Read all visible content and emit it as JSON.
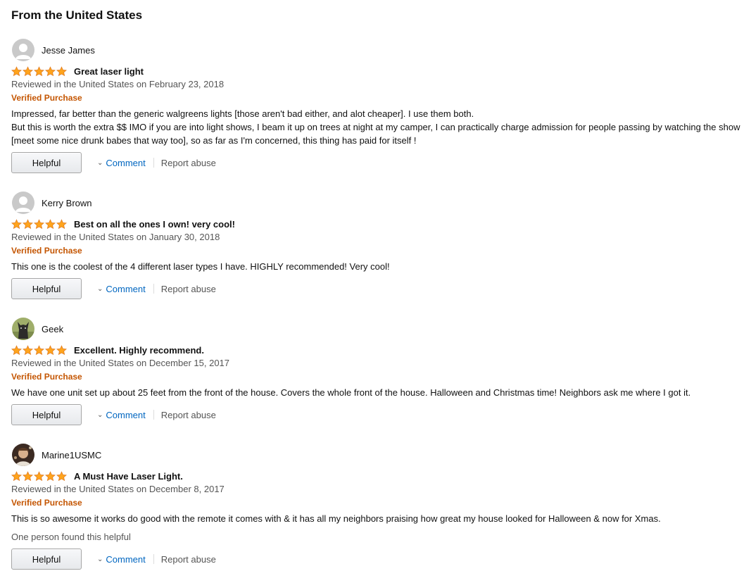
{
  "section_title": "From the United States",
  "colors": {
    "star": "#ffa41c",
    "verified": "#c45500",
    "link": "#0066c0"
  },
  "labels": {
    "helpful": "Helpful",
    "comment": "Comment",
    "report": "Report abuse"
  },
  "reviews": [
    {
      "name": "Jesse James",
      "avatar": "default-avatar-icon",
      "rating": 5,
      "title": "Great laser light",
      "date": "Reviewed in the United States on February 23, 2018",
      "verified": "Verified Purchase",
      "body": [
        "Impressed, far better than the generic walgreens lights [those aren't bad either, and alot cheaper]. I use them both.",
        "But this is worth the extra $$ IMO if you are into light shows, I beam it up on trees at night at my camper, I can practically charge admission for people passing by watching the show [meet some nice drunk babes that way too], so as far as I'm concerned, this thing has paid for itself !"
      ],
      "helpful_count": ""
    },
    {
      "name": "Kerry Brown",
      "avatar": "default-avatar-icon",
      "rating": 5,
      "title": "Best on all the ones I own! very cool!",
      "date": "Reviewed in the United States on January 30, 2018",
      "verified": "Verified Purchase",
      "body": [
        "This one is the coolest of the 4 different laser types I have. HIGHLY recommended! Very cool!"
      ],
      "helpful_count": ""
    },
    {
      "name": "Geek",
      "avatar": "dog-photo-avatar",
      "rating": 5,
      "title": "Excellent. Highly recommend.",
      "date": "Reviewed in the United States on December 15, 2017",
      "verified": "Verified Purchase",
      "body": [
        "We have one unit set up about 25 feet from the front of the house. Covers the whole front of the house. Halloween and Christmas time! Neighbors ask me where I got it."
      ],
      "helpful_count": ""
    },
    {
      "name": "Marine1USMC",
      "avatar": "person-photo-avatar",
      "rating": 5,
      "title": "A Must Have Laser Light.",
      "date": "Reviewed in the United States on December 8, 2017",
      "verified": "Verified Purchase",
      "body": [
        "This is so awesome it works do good with the remote it comes with & it has all my neighbors praising how great my house looked for Halloween & now for Xmas."
      ],
      "helpful_count": "One person found this helpful"
    }
  ]
}
